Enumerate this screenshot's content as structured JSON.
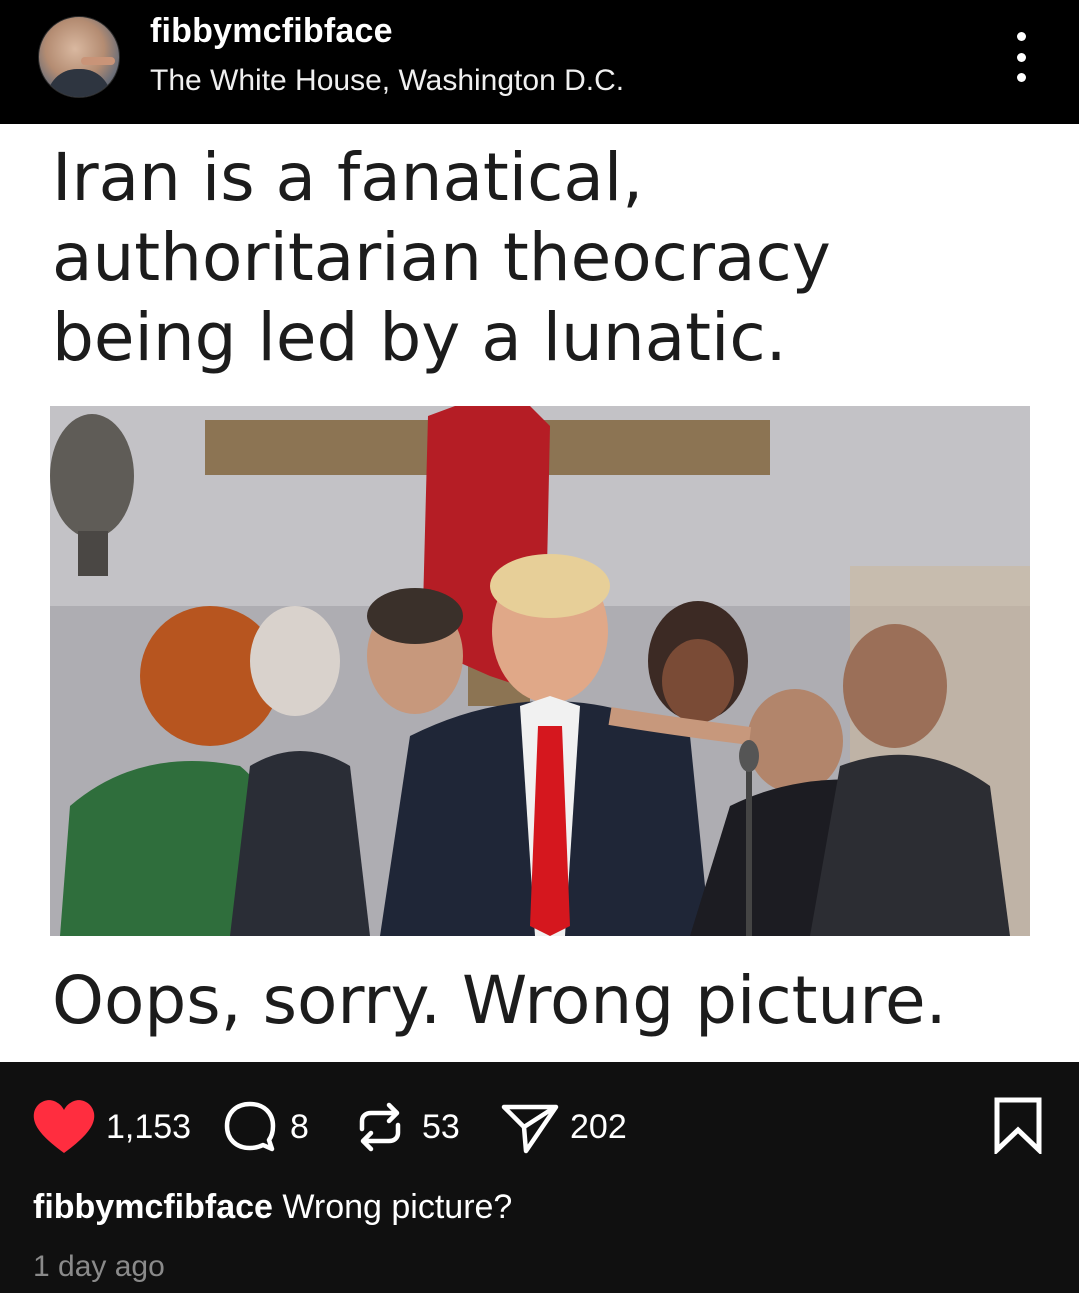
{
  "post": {
    "username": "fibbymcfibface",
    "location": "The White House, Washington D.C.",
    "more_icon": "more-vertical-icon"
  },
  "meme": {
    "title_lines": [
      "Iran is a fanatical,",
      "authoritarian theocracy",
      "being led by a lunatic."
    ],
    "caption": "Oops, sorry. Wrong picture."
  },
  "actions": {
    "likes": "1,153",
    "comments": "8",
    "reposts": "53",
    "shares": "202",
    "like_color": "#ff2d3f"
  },
  "caption": {
    "username": "fibbymcfibface",
    "text": "Wrong picture?",
    "timestamp": "1 day ago"
  }
}
